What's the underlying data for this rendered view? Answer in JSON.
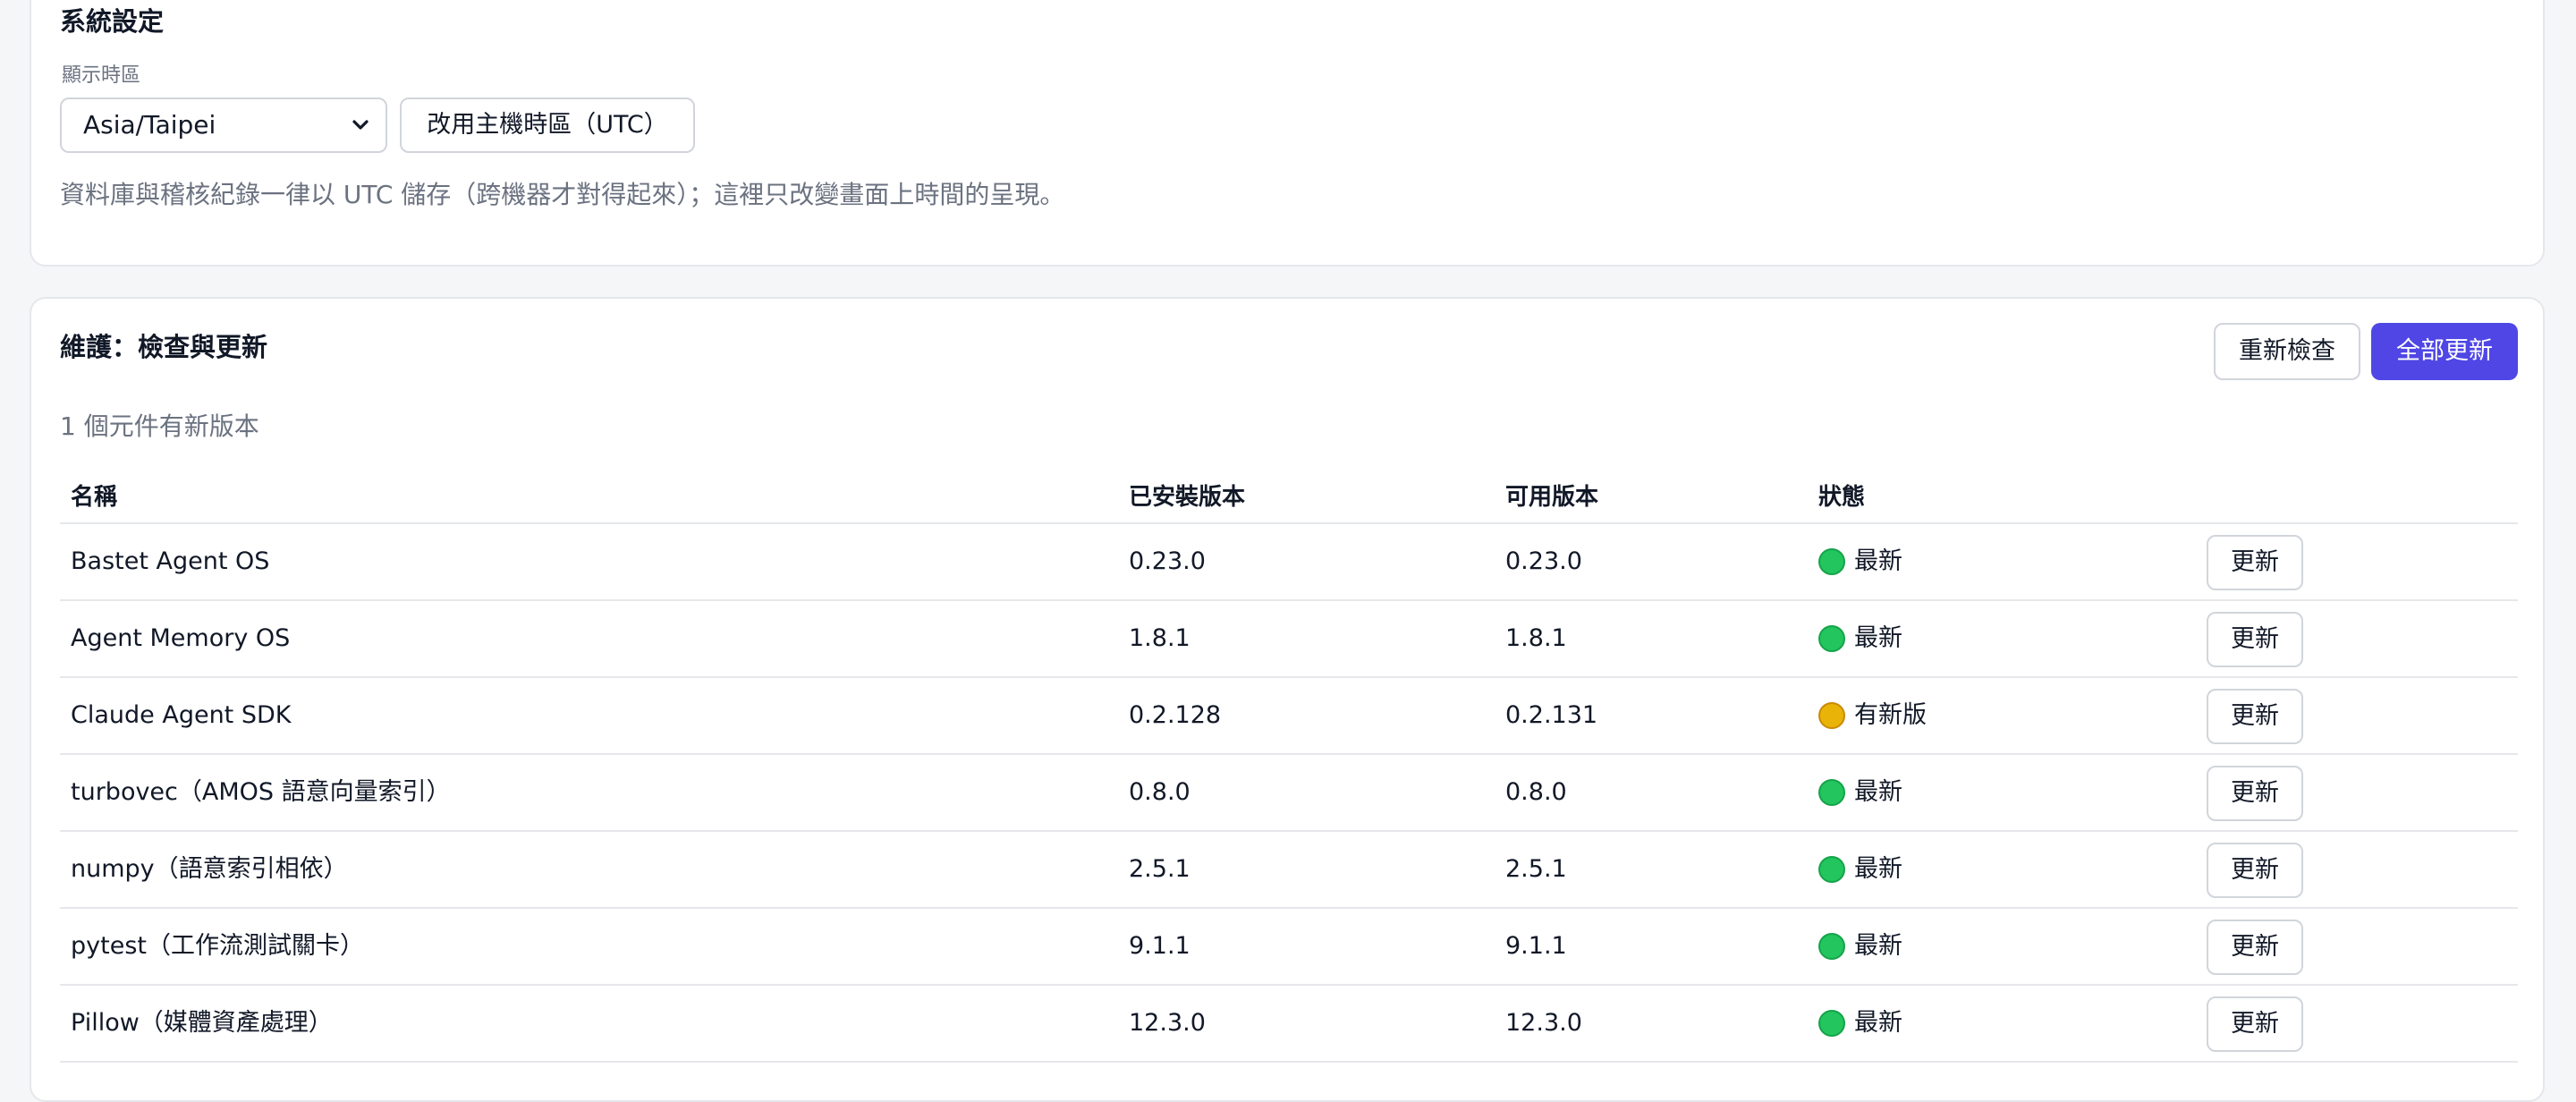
{
  "system": {
    "title": "系統設定",
    "timezone_label": "顯示時區",
    "timezone_value": "Asia/Taipei",
    "host_tz_button": "改用主機時區（UTC）",
    "note": "資料庫與稽核紀錄一律以 UTC 儲存（跨機器才對得起來）；這裡只改變畫面上時間的呈現。"
  },
  "maintenance": {
    "title": "維護：檢查與更新",
    "recheck_button": "重新檢查",
    "update_all_button": "全部更新",
    "summary": "1 個元件有新版本",
    "columns": {
      "name": "名稱",
      "installed": "已安裝版本",
      "available": "可用版本",
      "status": "狀態"
    },
    "update_label": "更新",
    "rows": [
      {
        "name": "Bastet Agent OS",
        "installed": "0.23.0",
        "available": "0.23.0",
        "status": "最新",
        "status_color": "#22c55e"
      },
      {
        "name": "Agent Memory OS",
        "installed": "1.8.1",
        "available": "1.8.1",
        "status": "最新",
        "status_color": "#22c55e"
      },
      {
        "name": "Claude Agent SDK",
        "installed": "0.2.128",
        "available": "0.2.131",
        "status": "有新版",
        "status_color": "#eab308"
      },
      {
        "name": "turbovec（AMOS 語意向量索引）",
        "installed": "0.8.0",
        "available": "0.8.0",
        "status": "最新",
        "status_color": "#22c55e"
      },
      {
        "name": "numpy（語意索引相依）",
        "installed": "2.5.1",
        "available": "2.5.1",
        "status": "最新",
        "status_color": "#22c55e"
      },
      {
        "name": "pytest（工作流測試關卡）",
        "installed": "9.1.1",
        "available": "9.1.1",
        "status": "最新",
        "status_color": "#22c55e"
      },
      {
        "name": "Pillow（媒體資產處理）",
        "installed": "12.3.0",
        "available": "12.3.0",
        "status": "最新",
        "status_color": "#22c55e"
      }
    ]
  },
  "colors": {
    "accent": "#4f46e5",
    "ok": "#22c55e",
    "warn": "#eab308"
  }
}
